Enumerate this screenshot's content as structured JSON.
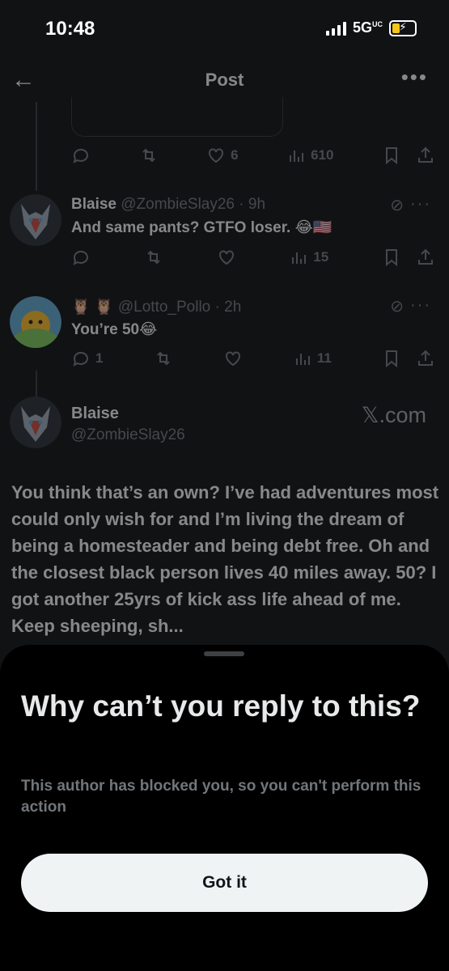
{
  "status_bar": {
    "time": "10:48",
    "network": "5G",
    "network_suffix": "UC"
  },
  "header": {
    "title": "Post",
    "back_icon": "arrow-left-icon",
    "more_icon": "more-horizontal-icon"
  },
  "top_actions": {
    "likes": "6",
    "views": "610"
  },
  "replies": [
    {
      "name": "Blaise",
      "handle": "@ZombieSlay26",
      "time": "9h",
      "text": "And same pants? GTFO loser. 😂🇺🇸",
      "views": "15"
    },
    {
      "name": "🦉 🦉",
      "handle": "@Lotto_Pollo",
      "time": "2h",
      "text": "You’re 50😂",
      "replies": "1",
      "views": "11"
    }
  ],
  "main_post": {
    "name": "Blaise",
    "handle": "@ZombieSlay26",
    "watermark": "𝕏.com",
    "body": "You think that’s an own? I’ve had adventures most could only wish for and I’m living the dream of being a homesteader and being debt free. Oh and the closest black person lives 40 miles away. 50? I got another 25yrs of kick ass life ahead of me. Keep sheeping, sh..."
  },
  "sheet": {
    "title": "Why can’t you reply to this?",
    "description": "This author has blocked you, so you can't perform this action",
    "button": "Got it"
  },
  "colors": {
    "background": "#000000",
    "text": "#e7e9ea",
    "muted": "#71767b",
    "button": "#eff3f4"
  }
}
